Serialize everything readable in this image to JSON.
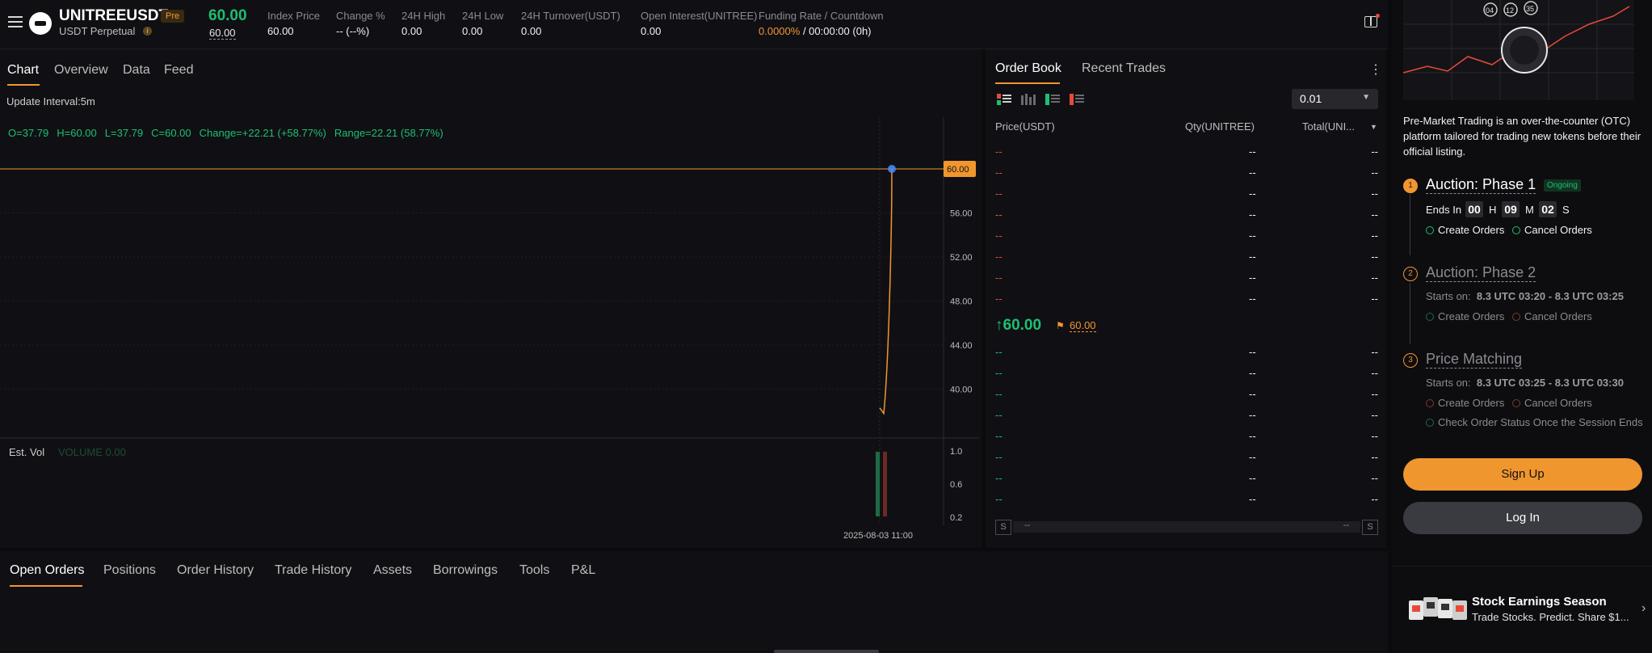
{
  "header": {
    "symbol": "UNITREEUSDT",
    "pre_badge": "Pre",
    "subtitle": "USDT Perpetual",
    "info_glyph": "i",
    "last_price": "60.00",
    "mark_price": "60.00",
    "stats": [
      {
        "label": "Index Price",
        "value": "60.00"
      },
      {
        "label": "Change %",
        "value": "-- (--%)"
      },
      {
        "label": "24H High",
        "value": "0.00"
      },
      {
        "label": "24H Low",
        "value": "0.00"
      },
      {
        "label": "24H Turnover(USDT)",
        "value": "0.00"
      },
      {
        "label": "Open Interest(UNITREE)",
        "value": "0.00"
      }
    ],
    "funding": {
      "label": "Funding Rate / Countdown",
      "rate": "0.0000%",
      "countdown": " / 00:00:00 (0h)"
    }
  },
  "chart_panel": {
    "tabs": [
      "Chart",
      "Overview",
      "Data",
      "Feed"
    ],
    "update_interval": "Update Interval:5m",
    "ohlc": [
      "O=37.79",
      "H=60.00",
      "L=37.79",
      "C=60.00",
      "Change=+22.21 (+58.77%)",
      "Range=22.21 (58.77%)"
    ],
    "est_vol": "Est. Vol",
    "volume_label": "VOLUME 0.00",
    "date_label": "2025-08-03 11:00"
  },
  "chart_data": {
    "type": "line",
    "series": [
      {
        "values": [
          38.3,
          37.79,
          60.0
        ]
      }
    ],
    "price_axis": [
      "56.00",
      "52.00",
      "48.00",
      "44.00",
      "40.00"
    ],
    "price_axis_values": [
      56,
      52,
      48,
      44,
      40
    ],
    "current_price_label": "60.00",
    "current_price": 60.0,
    "volume_axis": [
      "1.0",
      "0.6",
      "0.2"
    ],
    "volume_axis_values": [
      1.0,
      0.6,
      0.2
    ],
    "x_label": "2025-08-03 11:00"
  },
  "orderbook": {
    "tabs": [
      "Order Book",
      "Recent Trades"
    ],
    "kebab": "⋮",
    "tick_size": "0.01",
    "columns": [
      "Price(USDT)",
      "Qty(UNITREE)",
      "Total(UNI..."
    ],
    "asks": [
      [
        "--",
        "--",
        "--"
      ],
      [
        "--",
        "--",
        "--"
      ],
      [
        "--",
        "--",
        "--"
      ],
      [
        "--",
        "--",
        "--"
      ],
      [
        "--",
        "--",
        "--"
      ],
      [
        "--",
        "--",
        "--"
      ],
      [
        "--",
        "--",
        "--"
      ],
      [
        "--",
        "--",
        "--"
      ]
    ],
    "bids": [
      [
        "--",
        "--",
        "--"
      ],
      [
        "--",
        "--",
        "--"
      ],
      [
        "--",
        "--",
        "--"
      ],
      [
        "--",
        "--",
        "--"
      ],
      [
        "--",
        "--",
        "--"
      ],
      [
        "--",
        "--",
        "--"
      ],
      [
        "--",
        "--",
        "--"
      ],
      [
        "--",
        "--",
        "--"
      ]
    ],
    "mid_price": "↑60.00",
    "mid_flag": "⚑",
    "mark_price": "60.00",
    "ratio": {
      "left_badge": "S",
      "left_text": "--",
      "right_text": "--",
      "right_badge": "S"
    }
  },
  "bottom_tabs": [
    "Open Orders",
    "Positions",
    "Order History",
    "Trade History",
    "Assets",
    "Borrowings",
    "Tools",
    "P&L"
  ],
  "right_panel": {
    "hero_numbers": [
      "04",
      "12",
      "35"
    ],
    "intro": "Pre-Market Trading is an over-the-counter (OTC) platform tailored for trading new tokens before their official listing.",
    "steps": [
      {
        "num": "1",
        "title": "Auction: Phase 1",
        "badge": "Ongoing",
        "ends_label": "Ends In",
        "countdown": [
          "00",
          "09",
          "02"
        ],
        "units": [
          "H",
          "M",
          "S"
        ],
        "perms": [
          "Create Orders",
          "Cancel Orders"
        ]
      },
      {
        "num": "2",
        "title": "Auction: Phase 2",
        "starts_label": "Starts on:",
        "starts_value": "8.3 UTC 03:20 - 8.3 UTC 03:25",
        "perms": [
          "Create Orders",
          "Cancel Orders"
        ]
      },
      {
        "num": "3",
        "title": "Price Matching",
        "starts_label": "Starts on:",
        "starts_value": "8.3 UTC 03:25 - 8.3 UTC 03:30",
        "perms": [
          "Create Orders",
          "Cancel Orders",
          "Check Order Status Once the Session Ends"
        ]
      }
    ],
    "signup": "Sign Up",
    "login": "Log In",
    "promo_title": "Stock Earnings Season",
    "promo_sub": "Trade Stocks. Predict. Share $1...",
    "chevron": "›"
  },
  "colors": {
    "accent": "#f0962f",
    "green": "#1dbf73",
    "red": "#e74a3b"
  }
}
